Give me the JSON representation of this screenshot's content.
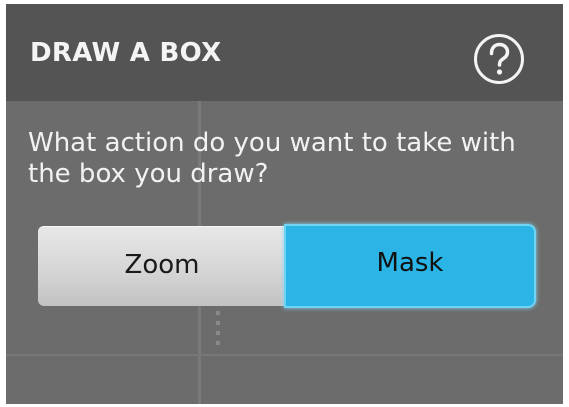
{
  "dialog": {
    "title": "DRAW A BOX",
    "help_icon": "question-mark-circle-icon",
    "prompt": "What action do you want to take with the box you draw?",
    "options": [
      {
        "label": "Zoom",
        "selected": false
      },
      {
        "label": "Mask",
        "selected": true
      }
    ]
  },
  "colors": {
    "header_bg": "#545454",
    "body_bg": "#6c6c6c",
    "selected_accent": "#2bb5e6",
    "unselected_button": "#d6d6d6"
  }
}
